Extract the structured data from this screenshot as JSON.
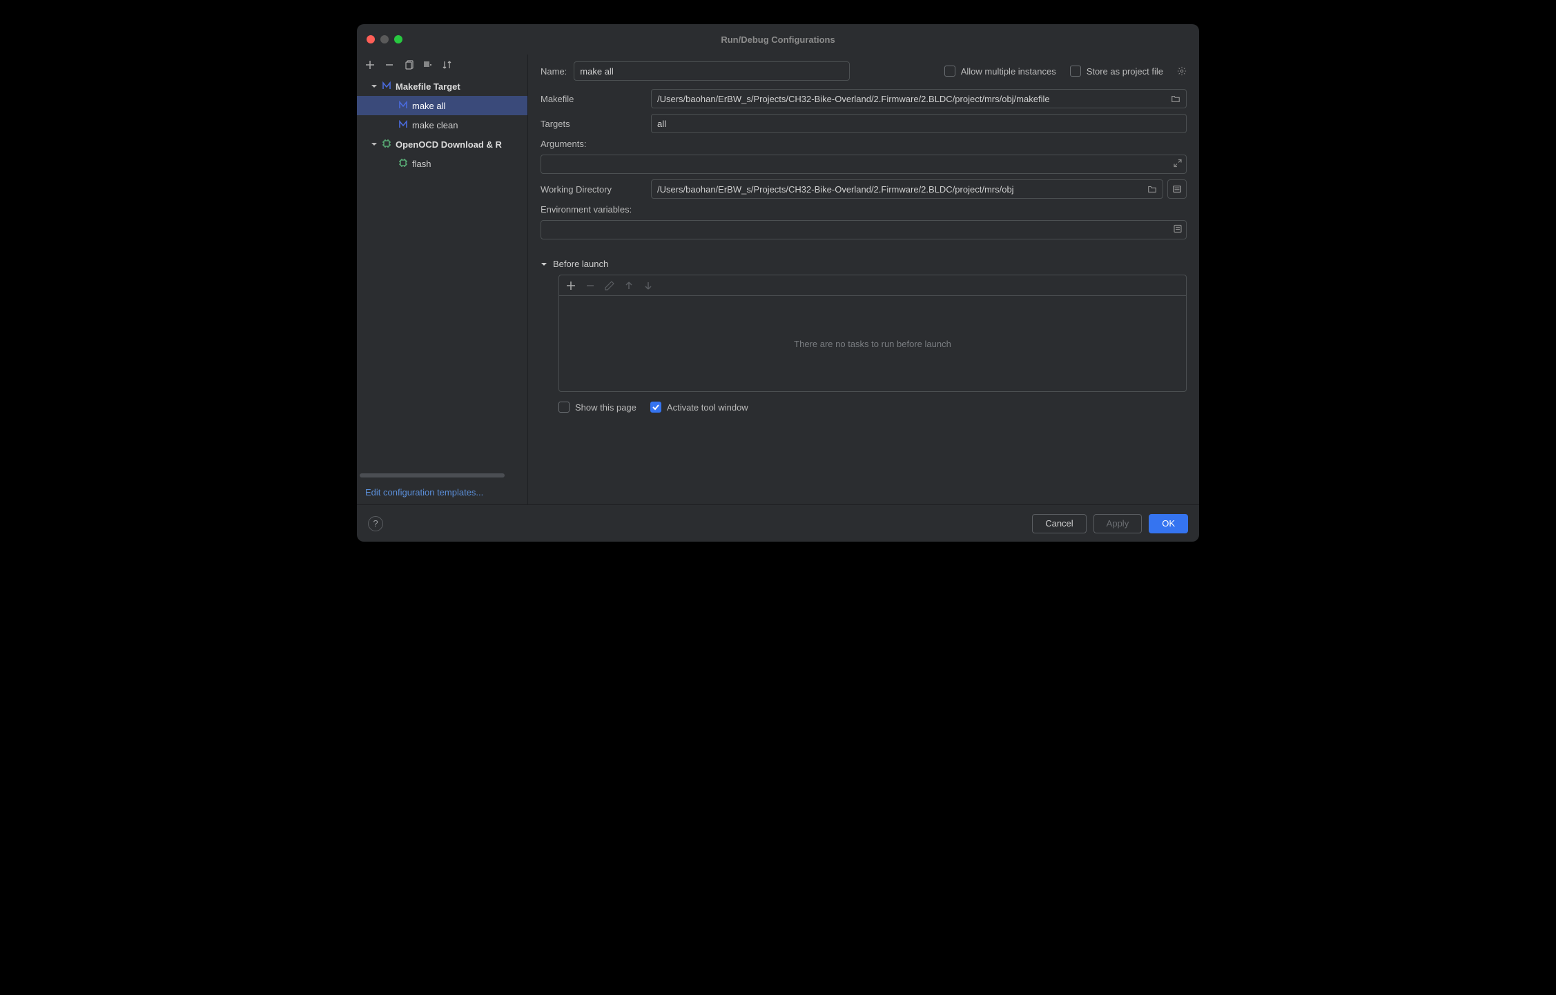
{
  "window": {
    "title": "Run/Debug Configurations"
  },
  "sidebar": {
    "groups": [
      {
        "label": "Makefile Target",
        "items": [
          {
            "label": "make all"
          },
          {
            "label": "make clean"
          }
        ]
      },
      {
        "label": "OpenOCD Download & R",
        "items": [
          {
            "label": "flash"
          }
        ]
      }
    ],
    "footer_link": "Edit configuration templates..."
  },
  "form": {
    "name_label": "Name:",
    "name_value": "make all",
    "allow_multiple_label": "Allow multiple instances",
    "store_project_label": "Store as project file",
    "makefile_label": "Makefile",
    "makefile_value": "/Users/baohan/ErBW_s/Projects/CH32-Bike-Overland/2.Firmware/2.BLDC/project/mrs/obj/makefile",
    "targets_label": "Targets",
    "targets_value": "all",
    "arguments_label": "Arguments:",
    "arguments_value": "",
    "workdir_label": "Working Directory",
    "workdir_value": "/Users/baohan/ErBW_s/Projects/CH32-Bike-Overland/2.Firmware/2.BLDC/project/mrs/obj",
    "env_label": "Environment variables:",
    "env_value": "",
    "before_launch_label": "Before launch",
    "before_launch_empty": "There are no tasks to run before launch",
    "show_page_label": "Show this page",
    "activate_tool_label": "Activate tool window"
  },
  "footer": {
    "cancel": "Cancel",
    "apply": "Apply",
    "ok": "OK"
  }
}
